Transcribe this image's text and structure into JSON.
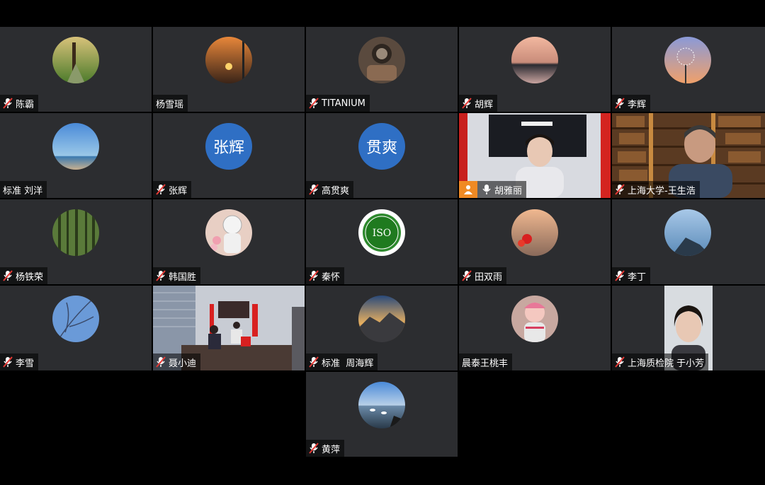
{
  "participants": [
    {
      "name": "陈霸",
      "muted": true,
      "avatar": "forest-path-photo"
    },
    {
      "name": "杨雪瑶",
      "muted": false,
      "avatar": "sunset-photo"
    },
    {
      "name": "TITANIUM",
      "muted": true,
      "avatar": "watch-photo"
    },
    {
      "name": "胡辉",
      "muted": true,
      "avatar": "dusk-lake-photo"
    },
    {
      "name": "李辉",
      "muted": true,
      "avatar": "dandelion-photo"
    },
    {
      "name": "标准 刘洋",
      "muted": false,
      "avatar": "beach-photo"
    },
    {
      "name": "张辉",
      "muted": true,
      "avatar_text": "张辉"
    },
    {
      "name": "高贯爽",
      "muted": true,
      "avatar_text": "贯爽"
    },
    {
      "name": "胡雅丽",
      "muted": false,
      "host": true,
      "video": "woman-office-video"
    },
    {
      "name": "上海大学-王生浩",
      "muted": true,
      "video": "man-bookshelf-video"
    },
    {
      "name": "杨铁荣",
      "muted": true,
      "avatar": "bamboo-forest-photo"
    },
    {
      "name": "韩国胜",
      "muted": true,
      "avatar": "astronaut-photo"
    },
    {
      "name": "秦怀",
      "muted": true,
      "avatar": "iso-logo",
      "avatar_logo_text": "ISO"
    },
    {
      "name": "田双雨",
      "muted": true,
      "avatar": "flowers-sky-photo"
    },
    {
      "name": "李丁",
      "muted": true,
      "avatar": "sea-rock-photo"
    },
    {
      "name": "李雪",
      "muted": true,
      "avatar": "tree-sky-photo"
    },
    {
      "name": "聂小迪",
      "muted": true,
      "video": "office-desk-video"
    },
    {
      "name": "标准  周海辉",
      "muted": true,
      "avatar": "mountain-clouds-photo"
    },
    {
      "name": "晨泰王桃丰",
      "muted": false,
      "avatar": "child-photo"
    },
    {
      "name": "上海质检院 于小芳",
      "muted": true,
      "video": "woman-portrait-video"
    },
    {
      "name": "黄萍",
      "muted": true,
      "avatar": "lake-swans-photo"
    }
  ]
}
